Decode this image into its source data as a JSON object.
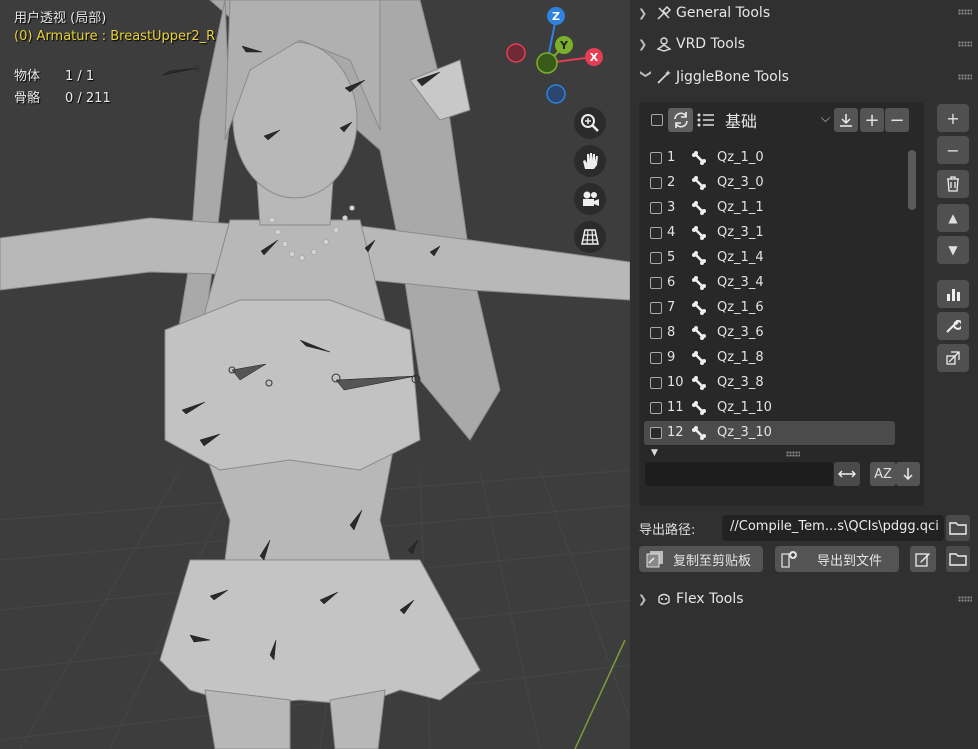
{
  "viewport": {
    "view_name": "用户透视 (局部)",
    "active_object": "(0) Armature : BreastUpper2_R",
    "stats": [
      {
        "label": "物体",
        "value": "1 / 1"
      },
      {
        "label": "骨骼",
        "value": "0 / 211"
      }
    ],
    "gizmo": {
      "z": "Z",
      "y": "Y",
      "x": "X"
    },
    "nav_icons": [
      "zoom-icon",
      "hand-pan-icon",
      "camera-icon",
      "grid-ortho-icon"
    ],
    "colors": {
      "x_axis": "#e43d54",
      "y_axis": "#7bb12a",
      "z_axis": "#2f83e0",
      "background": "#3d3d3d"
    }
  },
  "panel": {
    "sections": [
      {
        "title": "General Tools",
        "expanded": false,
        "icon": "tools-icon"
      },
      {
        "title": "VRD Tools",
        "expanded": false,
        "icon": "vrd-icon"
      },
      {
        "title": "JiggleBone Tools",
        "expanded": true,
        "icon": "wand-icon"
      }
    ],
    "jigglebone": {
      "preset_select": "基础",
      "bones": [
        {
          "index": "1",
          "name": "Qz_1_0"
        },
        {
          "index": "2",
          "name": "Qz_3_0"
        },
        {
          "index": "3",
          "name": "Qz_1_1"
        },
        {
          "index": "4",
          "name": "Qz_3_1"
        },
        {
          "index": "5",
          "name": "Qz_1_4"
        },
        {
          "index": "6",
          "name": "Qz_3_4"
        },
        {
          "index": "7",
          "name": "Qz_1_6"
        },
        {
          "index": "8",
          "name": "Qz_3_6"
        },
        {
          "index": "9",
          "name": "Qz_1_8"
        },
        {
          "index": "10",
          "name": "Qz_3_8"
        },
        {
          "index": "11",
          "name": "Qz_1_10"
        },
        {
          "index": "12",
          "name": "Qz_3_10"
        }
      ],
      "active_row": 12,
      "filter_value": "",
      "sort_label": "AZ"
    },
    "export": {
      "path_label": "导出路径:",
      "path_value": "//Compile_Tem...s\\QCIs\\pdgg.qci",
      "copy_button": "复制至剪贴板",
      "export_button": "导出到文件"
    },
    "flex": {
      "title": "Flex Tools",
      "expanded": false,
      "icon": "flex-icon"
    }
  }
}
